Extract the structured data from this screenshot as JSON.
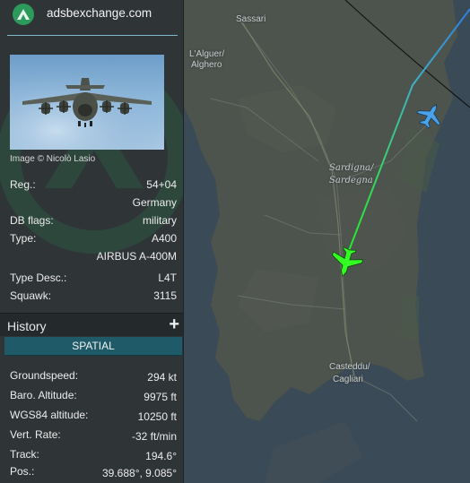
{
  "sidebar": {
    "brand": {
      "site": "adsbexchange.com",
      "logo_icon": "adsbexchange-logo-icon"
    },
    "photo": {
      "credit": "Image © Nicolò Lasio"
    },
    "details": [
      {
        "label": "Reg.:",
        "value": "54+04"
      },
      {
        "label": "",
        "value": "Germany"
      },
      {
        "label": "DB flags:",
        "value": "military"
      },
      {
        "label": "Type:",
        "value": "A400"
      },
      {
        "label": "",
        "value": "AIRBUS A-400M"
      },
      {
        "label": "Type Desc.:",
        "value": "L4T"
      },
      {
        "label": "Squawk:",
        "value": "3115"
      }
    ],
    "history": {
      "title": "History",
      "toggle": "+"
    },
    "spatial_tab": "SPATIAL",
    "spatial": [
      {
        "label": "Groundspeed:",
        "value": "294 kt"
      },
      {
        "label": "Baro. Altitude:",
        "value": "9975 ft"
      },
      {
        "label": "WGS84 altitude:",
        "value": "10250 ft"
      },
      {
        "label": "Vert. Rate:",
        "value": "-32 ft/min"
      },
      {
        "label": "Track:",
        "value": "194.6°"
      },
      {
        "label": "Pos.:",
        "value": "39.688°, 9.085°"
      }
    ]
  },
  "map": {
    "labels": {
      "sassari": "Sassari",
      "alghero_1": "L'Alguer/",
      "alghero_2": "Alghero",
      "sardegna_1": "Sardigna/",
      "sardegna_2": "Sardegna",
      "cagliari_1": "Casteddu/",
      "cagliari_2": "Cagliari"
    },
    "colors": {
      "selected_aircraft": "#33ff22",
      "other_aircraft": "#4aa3e8",
      "track_top": "#2f7fe0",
      "track_bottom": "#22ee22"
    }
  }
}
